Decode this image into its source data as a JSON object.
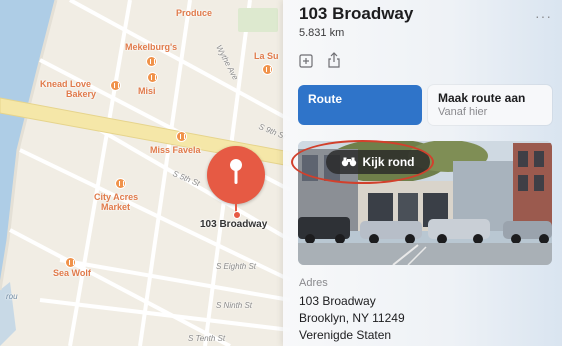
{
  "map": {
    "labels": {
      "produce": "Produce",
      "mekelburgs": "Mekelburg's",
      "la_su": "La Su",
      "knead_love": "Knead Love",
      "bakery": "Bakery",
      "misi": "Misi",
      "wythe_ave": "Wythe Ave",
      "miss_favela": "Miss Favela",
      "city_acres": "City Acres",
      "market": "Market",
      "sea_wolf": "Sea Wolf",
      "s_9th": "S 9th St",
      "s_5th": "S 5th St",
      "s_8th": "S Eighth St",
      "s_9th_b": "S Ninth St",
      "s_10th": "S Tenth St",
      "rou": "rou"
    },
    "pin_label": "103 Broadway",
    "colors": {
      "land": "#f1ede4",
      "water": "#aecde6",
      "bridge": "#f5e7a8",
      "pin": "#e65a44",
      "poi": "#f0924a"
    }
  },
  "panel": {
    "title": "103 Broadway",
    "distance": "5.831 km",
    "actions": {
      "add_icon": "add-to-guide-icon",
      "share_icon": "share-icon"
    },
    "route_button": "Route",
    "make_route": {
      "title": "Maak route aan",
      "subtitle": "Vanaf hier"
    },
    "look_around": "Kijk rond",
    "address": {
      "header": "Adres",
      "lines": [
        "103 Broadway",
        "Brooklyn, NY  11249",
        "Verenigde Staten"
      ]
    },
    "colors": {
      "primary": "#2f74c9",
      "annotation": "#d2402c"
    }
  }
}
